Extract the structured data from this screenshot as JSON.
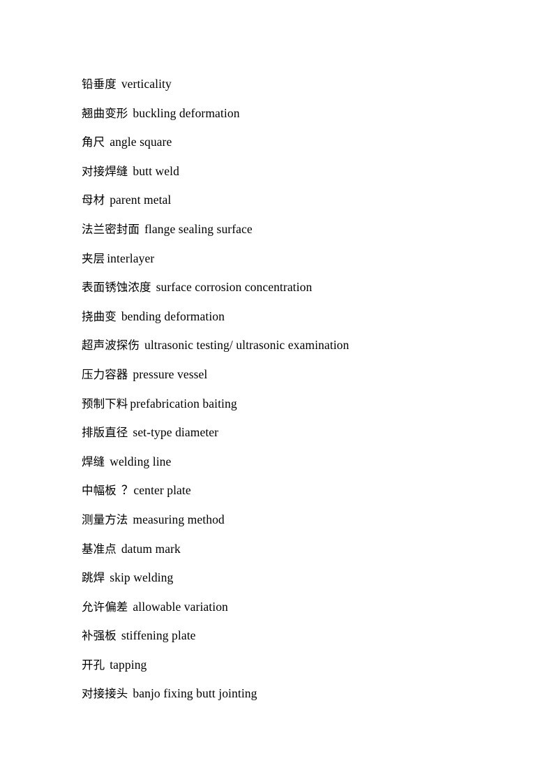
{
  "document": {
    "type": "glossary-list",
    "language_pair": "Chinese-English",
    "background_color": "#ffffff",
    "text_color": "#000000",
    "entry_count": 21
  },
  "entries": [
    {
      "term": "铅垂度",
      "separator": "wide",
      "gloss": "verticality"
    },
    {
      "term": "翘曲变形",
      "separator": "wide",
      "gloss": "buckling deformation"
    },
    {
      "term": "角尺",
      "separator": "wide",
      "gloss": "angle square"
    },
    {
      "term": "对接焊缝",
      "separator": "wide",
      "gloss": "butt weld"
    },
    {
      "term": "母材",
      "separator": "wide",
      "gloss": "parent metal"
    },
    {
      "term": "法兰密封面",
      "separator": "wide",
      "gloss": "flange sealing surface"
    },
    {
      "term": "夹层",
      "separator": "narrow",
      "gloss": "interlayer"
    },
    {
      "term": "表面锈蚀浓度",
      "separator": "wide",
      "gloss": "surface corrosion concentration"
    },
    {
      "term": "挠曲变",
      "separator": "wide",
      "gloss": "bending deformation"
    },
    {
      "term": "超声波探伤",
      "separator": "wide",
      "gloss": "ultrasonic testing/ ultrasonic examination"
    },
    {
      "term": "压力容器",
      "separator": "wide",
      "gloss": "pressure vessel"
    },
    {
      "term": "预制下料",
      "separator": "narrow",
      "gloss": "prefabrication baiting"
    },
    {
      "term": "排版直径",
      "separator": "wide",
      "gloss": "set-type diameter"
    },
    {
      "term": "焊缝",
      "separator": "wide",
      "gloss": "welding line"
    },
    {
      "term": "中幅板",
      "separator": "wide",
      "gloss": "？center plate"
    },
    {
      "term": "测量方法",
      "separator": "wide",
      "gloss": "measuring method"
    },
    {
      "term": "基准点",
      "separator": "wide",
      "gloss": "datum mark"
    },
    {
      "term": "跳焊",
      "separator": "wide",
      "gloss": "skip welding"
    },
    {
      "term": "允许偏差",
      "separator": "wide",
      "gloss": "allowable variation"
    },
    {
      "term": "补强板",
      "separator": "wide",
      "gloss": "stiffening plate"
    },
    {
      "term": "开孔",
      "separator": "wide",
      "gloss": "tapping"
    },
    {
      "term": "对接接头",
      "separator": "wide",
      "gloss": "banjo fixing butt jointing"
    }
  ]
}
